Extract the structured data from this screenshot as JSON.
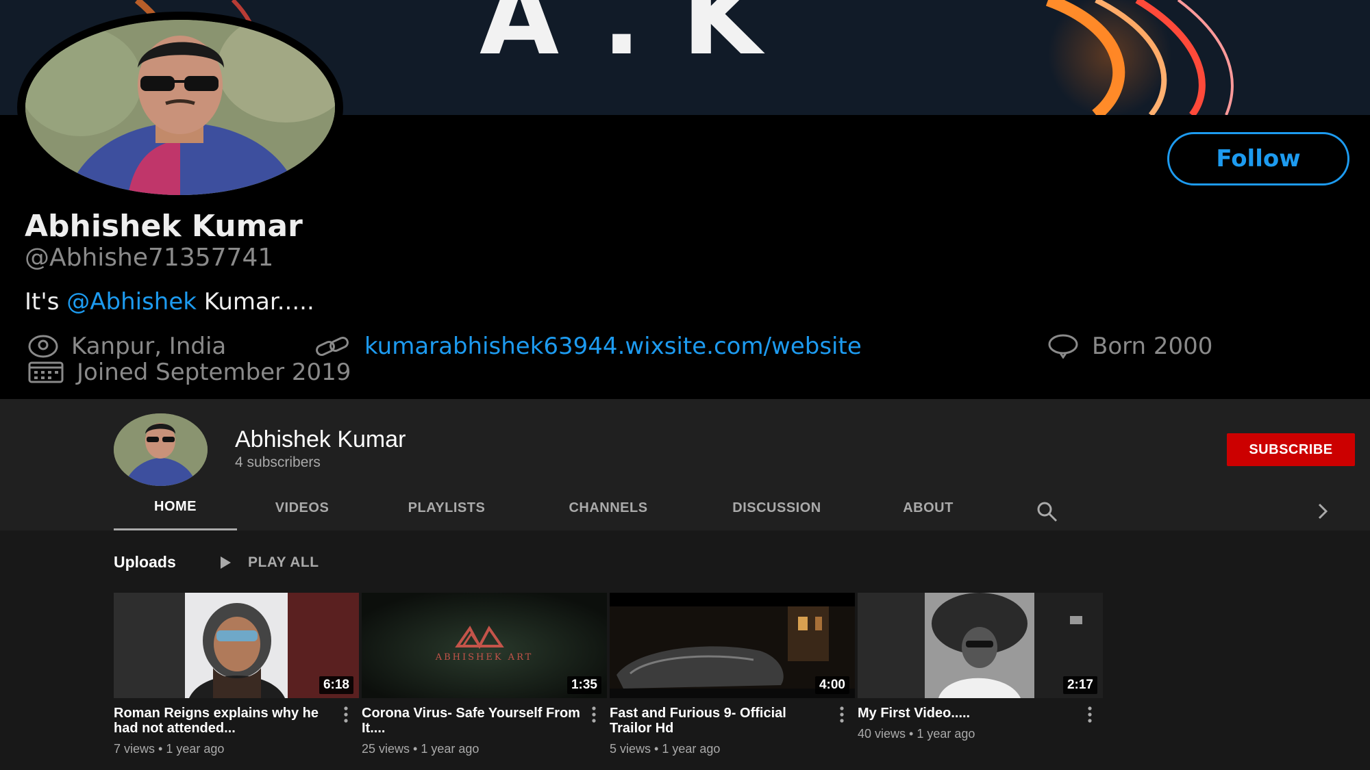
{
  "twitter": {
    "banner_text": "A.K",
    "follow_label": "Follow",
    "name": "Abhishek Kumar",
    "handle": "@Abhishe71357741",
    "bio_prefix": "It's ",
    "bio_mention": "@Abhishek",
    "bio_suffix": " Kumar.....",
    "location": "Kanpur, India",
    "website": "kumarabhishek63944.wixsite.com/website",
    "born": "Born 2000",
    "joined": "Joined September 2019",
    "icons": [
      "location-icon",
      "link-icon",
      "balloon-icon",
      "calendar-icon"
    ],
    "accent_color": "#1d9bf0"
  },
  "youtube": {
    "channel_name": "Abhishek Kumar",
    "subscribers": "4 subscribers",
    "subscribe_label": "SUBSCRIBE",
    "subscribe_color": "#cc0000",
    "tabs": [
      {
        "label": "HOME",
        "active": true
      },
      {
        "label": "VIDEOS",
        "active": false
      },
      {
        "label": "PLAYLISTS",
        "active": false
      },
      {
        "label": "CHANNELS",
        "active": false
      },
      {
        "label": "DISCUSSION",
        "active": false
      },
      {
        "label": "ABOUT",
        "active": false
      }
    ],
    "uploads_label": "Uploads",
    "play_all_label": "PLAY ALL",
    "videos": [
      {
        "title": "Roman Reigns explains why he had not attended...",
        "duration": "6:18",
        "views": "7 views",
        "age": "1 year ago"
      },
      {
        "title": "Corona Virus- Safe Yourself From It....",
        "duration": "1:35",
        "views": "25 views",
        "age": "1 year ago",
        "thumb_text": "ABHISHEK ART"
      },
      {
        "title": "Fast and Furious 9- Official Trailor Hd",
        "duration": "4:00",
        "views": "5 views",
        "age": "1 year ago"
      },
      {
        "title": "My First Video.....",
        "duration": "2:17",
        "views": "40 views",
        "age": "1 year ago"
      }
    ]
  }
}
